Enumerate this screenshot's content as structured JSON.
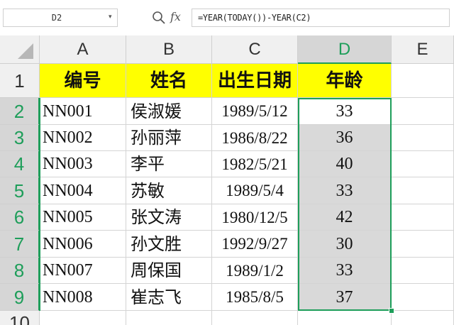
{
  "formula_bar": {
    "name_box": "D2",
    "formula": "=YEAR(TODAY())-YEAR(C2)",
    "zoom_icon": "magnifier-icon",
    "fx_label": "fx"
  },
  "columns": [
    "A",
    "B",
    "C",
    "D",
    "E"
  ],
  "rows": [
    "1",
    "2",
    "3",
    "4",
    "5",
    "6",
    "7",
    "8",
    "9",
    "10"
  ],
  "selected_column": "D",
  "header_row": [
    "编号",
    "姓名",
    "出生日期",
    "年龄"
  ],
  "table": [
    {
      "id": "NN001",
      "name": "侯淑媛",
      "birth": "1989/5/12",
      "age": "33"
    },
    {
      "id": "NN002",
      "name": "孙丽萍",
      "birth": "1986/8/22",
      "age": "36"
    },
    {
      "id": "NN003",
      "name": "李平",
      "birth": "1982/5/21",
      "age": "40"
    },
    {
      "id": "NN004",
      "name": "苏敏",
      "birth": "1989/5/4",
      "age": "33"
    },
    {
      "id": "NN005",
      "name": "张文涛",
      "birth": "1980/12/5",
      "age": "42"
    },
    {
      "id": "NN006",
      "name": "孙文胜",
      "birth": "1992/9/27",
      "age": "30"
    },
    {
      "id": "NN007",
      "name": "周保国",
      "birth": "1989/1/2",
      "age": "33"
    },
    {
      "id": "NN008",
      "name": "崔志飞",
      "birth": "1985/8/5",
      "age": "37"
    }
  ],
  "colors": {
    "header_fill": "#ffff00",
    "selection": "#1e9e5a",
    "selected_fill": "#d9d9d9"
  }
}
